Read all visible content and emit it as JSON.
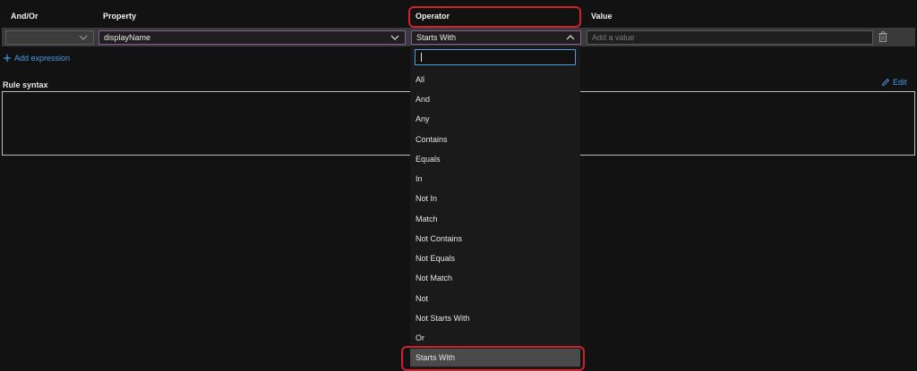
{
  "headers": {
    "andor": "And/Or",
    "property": "Property",
    "operator": "Operator",
    "value": "Value"
  },
  "row": {
    "andor_value": "",
    "property_value": "displayName",
    "operator_value": "Starts With",
    "value_placeholder": "Add a value"
  },
  "add_expression": "Add expression",
  "rule_syntax_label": "Rule syntax",
  "edit_label": "Edit",
  "operator_dropdown": {
    "search_value": "",
    "options": [
      "All",
      "And",
      "Any",
      "Contains",
      "Equals",
      "In",
      "Not In",
      "Match",
      "Not Contains",
      "Not Equals",
      "Not Match",
      "Not",
      "Not Starts With",
      "Or",
      "Starts With"
    ],
    "selected": "Starts With"
  },
  "icons": {
    "andor_chevron": "chevron-down-icon",
    "property_chevron": "chevron-down-icon",
    "operator_chevron": "chevron-up-icon",
    "delete": "trash-icon",
    "add": "plus-icon",
    "edit": "pencil-icon"
  },
  "colors": {
    "accent": "#4a9be8",
    "highlight_outline": "#d0202a",
    "background": "#121212"
  }
}
